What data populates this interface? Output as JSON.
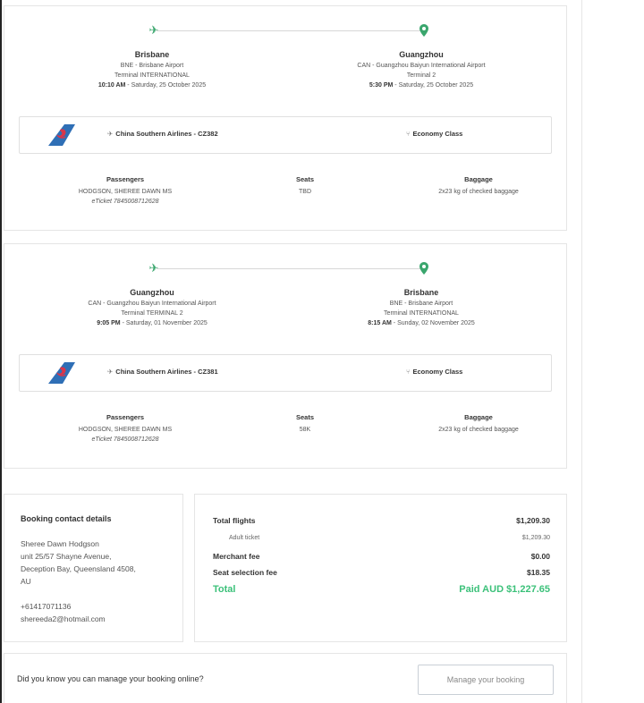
{
  "flights": [
    {
      "origin": {
        "city": "Brisbane",
        "airport": "BNE - Brisbane Airport",
        "terminal": "Terminal INTERNATIONAL",
        "time": "10:10 AM",
        "date": " - Saturday, 25 October 2025"
      },
      "destination": {
        "city": "Guangzhou",
        "airport": "CAN - Guangzhou Baiyun International Airport",
        "terminal": "Terminal 2",
        "time": "5:30 PM",
        "date": " - Saturday, 25 October 2025"
      },
      "airline": "China Southern Airlines - CZ382",
      "cabin": "Economy Class",
      "passengers_label": "Passengers",
      "seats_label": "Seats",
      "baggage_label": "Baggage",
      "passenger_name": "HODGSON, SHEREE DAWN MS",
      "eticket": "eTicket 7845008712628",
      "seat": "TBD",
      "baggage": "2x23 kg of checked baggage"
    },
    {
      "origin": {
        "city": "Guangzhou",
        "airport": "CAN - Guangzhou Baiyun International Airport",
        "terminal": "Terminal TERMINAL 2",
        "time": "9:05 PM",
        "date": " - Saturday, 01 November 2025"
      },
      "destination": {
        "city": "Brisbane",
        "airport": "BNE - Brisbane Airport",
        "terminal": "Terminal INTERNATIONAL",
        "time": "8:15 AM",
        "date": " - Sunday, 02 November 2025"
      },
      "airline": "China Southern Airlines - CZ381",
      "cabin": "Economy Class",
      "passengers_label": "Passengers",
      "seats_label": "Seats",
      "baggage_label": "Baggage",
      "passenger_name": "HODGSON, SHEREE DAWN MS",
      "eticket": "eTicket 7845008712628",
      "seat": "58K",
      "baggage": "2x23 kg of checked baggage"
    }
  ],
  "contact": {
    "title": "Booking contact details",
    "name": "Sheree Dawn Hodgson",
    "address1": "unit 25/57 Shayne Avenue,",
    "address2": "Deception Bay, Queensland 4508,",
    "address3": "AU",
    "phone": "+61417071136",
    "email": "shereeda2@hotmail.com"
  },
  "pricing": {
    "total_flights_label": "Total flights",
    "total_flights_value": "$1,209.30",
    "adult_ticket_label": "Adult ticket",
    "adult_ticket_value": "$1,209.30",
    "merchant_fee_label": "Merchant fee",
    "merchant_fee_value": "$0.00",
    "seat_fee_label": "Seat selection fee",
    "seat_fee_value": "$18.35",
    "total_label": "Total",
    "total_value": "Paid AUD $1,227.65",
    "accent_color": "#3cc17a"
  },
  "manage": {
    "question": "Did you know you can manage your booking online?",
    "button_label": "Manage your booking"
  },
  "icons": {
    "plane": "plane-icon",
    "pin": "location-pin-icon",
    "seat": "seat-icon",
    "brand_color": "#3aa66d"
  }
}
